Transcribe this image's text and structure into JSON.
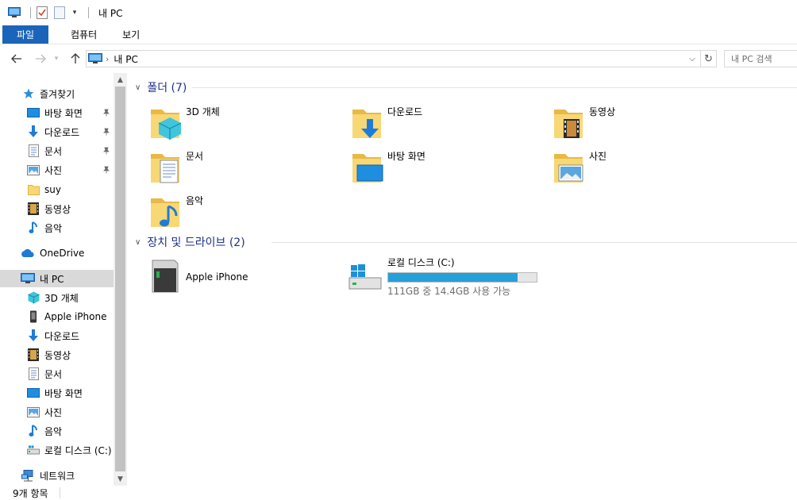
{
  "window": {
    "title": "내 PC"
  },
  "ribbon": {
    "tabs": [
      {
        "label": "파일"
      },
      {
        "label": "컴퓨터"
      },
      {
        "label": "보기"
      }
    ]
  },
  "address": {
    "breadcrumb": "내 PC",
    "search_placeholder": "내 PC 검색"
  },
  "nav": {
    "quick_access": "즐겨찾기",
    "quick_items": [
      {
        "label": "바탕 화면",
        "icon": "desktop-icon",
        "pinned": true
      },
      {
        "label": "다운로드",
        "icon": "download-icon",
        "pinned": true
      },
      {
        "label": "문서",
        "icon": "document-icon",
        "pinned": true
      },
      {
        "label": "사진",
        "icon": "picture-icon",
        "pinned": true
      },
      {
        "label": "suy",
        "icon": "folder-icon",
        "pinned": false
      },
      {
        "label": "동영상",
        "icon": "video-icon",
        "pinned": false
      },
      {
        "label": "음악",
        "icon": "music-icon",
        "pinned": false
      }
    ],
    "onedrive": "OneDrive",
    "this_pc": "내 PC",
    "pc_items": [
      {
        "label": "3D 개체",
        "icon": "3d-objects-icon"
      },
      {
        "label": "Apple iPhone",
        "icon": "phone-icon"
      },
      {
        "label": "다운로드",
        "icon": "download-icon"
      },
      {
        "label": "동영상",
        "icon": "video-icon"
      },
      {
        "label": "문서",
        "icon": "document-icon"
      },
      {
        "label": "바탕 화면",
        "icon": "desktop-icon"
      },
      {
        "label": "사진",
        "icon": "picture-icon"
      },
      {
        "label": "음악",
        "icon": "music-icon"
      },
      {
        "label": "로컬 디스크 (C:)",
        "icon": "drive-icon"
      }
    ],
    "network": "네트워크"
  },
  "content": {
    "folders_header": "폴더 (7)",
    "folders": [
      {
        "label": "3D 개체",
        "icon": "3d-objects-folder-icon"
      },
      {
        "label": "다운로드",
        "icon": "downloads-folder-icon"
      },
      {
        "label": "동영상",
        "icon": "videos-folder-icon"
      },
      {
        "label": "문서",
        "icon": "documents-folder-icon"
      },
      {
        "label": "바탕 화면",
        "icon": "desktop-folder-icon"
      },
      {
        "label": "사진",
        "icon": "pictures-folder-icon"
      },
      {
        "label": "음악",
        "icon": "music-folder-icon"
      }
    ],
    "devices_header": "장치 및 드라이브 (2)",
    "devices": [
      {
        "label": "Apple iPhone",
        "icon": "iphone-device-icon"
      },
      {
        "label": "로컬 디스크 (C:)",
        "icon": "local-disk-icon",
        "free_text": "111GB 중 14.4GB 사용 가능",
        "used_fraction": 0.87
      }
    ]
  },
  "status": {
    "item_count": "9개 항목"
  },
  "colors": {
    "accent": "#1a65b9",
    "header_text": "#1e3287",
    "drive_fill": "#26a0da",
    "selection": "#d9d9d9"
  }
}
